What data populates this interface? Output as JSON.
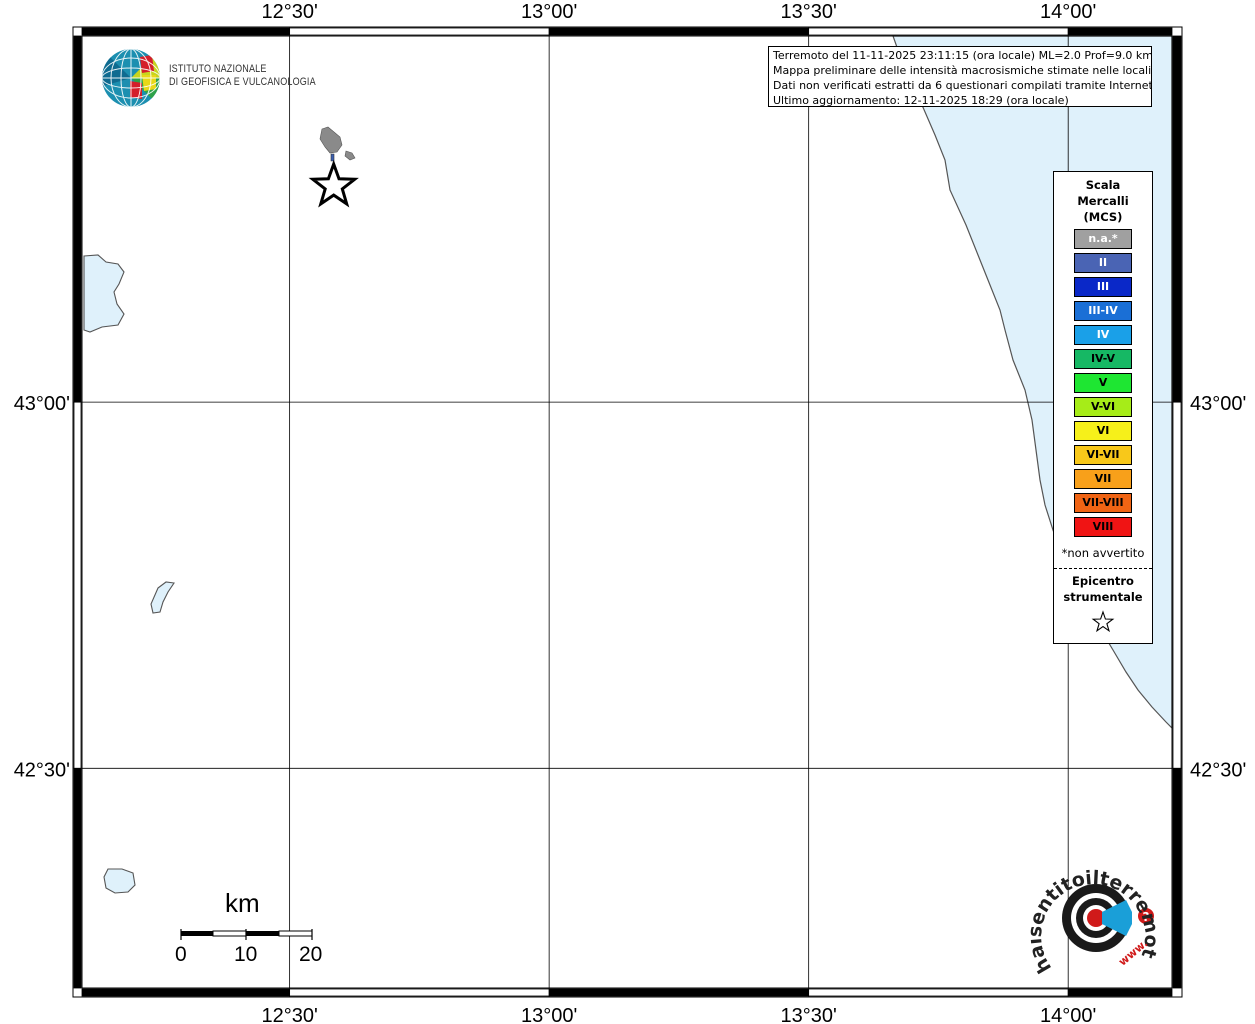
{
  "map": {
    "lon_range": [
      12.1,
      14.2
    ],
    "lat_range": [
      42.2,
      43.5
    ],
    "lon_ticks": [
      {
        "value": 12.5,
        "label": "12°30'"
      },
      {
        "value": 13.0,
        "label": "13°00'"
      },
      {
        "value": 13.5,
        "label": "13°30'"
      },
      {
        "value": 14.0,
        "label": "14°00'"
      }
    ],
    "lat_ticks": [
      {
        "value": 43.0,
        "label": "43°00'"
      },
      {
        "value": 42.5,
        "label": "42°30'"
      }
    ],
    "epicenter": {
      "lon": 12.585,
      "lat": 43.295
    },
    "water_color": "#dff1fb",
    "coast_color": "#555555",
    "land_color": "#ffffff"
  },
  "logo": {
    "line1": "ISTITUTO NAZIONALE",
    "line2": "DI GEOFISICA E VULCANOLOGIA"
  },
  "info": {
    "line1": "Terremoto del 11-11-2025 23:11:15 (ora locale) ML=2.0 Prof=9.0 km",
    "line2": "Mappa preliminare delle intensità macrosismiche stimate nelle località",
    "line3": "Dati non verificati estratti da 6 questionari compilati tramite Internet.",
    "line4": "Ultimo aggiornamento: 12-11-2025 18:29 (ora locale)"
  },
  "legend": {
    "title1": "Scala",
    "title2": "Mercalli",
    "title3": "(MCS)",
    "items": [
      {
        "label": "n.a.*",
        "color": "#a0a0a0",
        "text": "#ffffff"
      },
      {
        "label": "II",
        "color": "#4a64b4",
        "text": "#ffffff"
      },
      {
        "label": "III",
        "color": "#0a28c8",
        "text": "#ffffff"
      },
      {
        "label": "III-IV",
        "color": "#1a6fd6",
        "text": "#ffffff"
      },
      {
        "label": "IV",
        "color": "#1aa0e8",
        "text": "#ffffff"
      },
      {
        "label": "IV-V",
        "color": "#16b864",
        "text": "#000000"
      },
      {
        "label": "V",
        "color": "#1ee632",
        "text": "#000000"
      },
      {
        "label": "V-VI",
        "color": "#a6ec18",
        "text": "#000000"
      },
      {
        "label": "VI",
        "color": "#f6f01a",
        "text": "#000000"
      },
      {
        "label": "VI-VII",
        "color": "#f8c81a",
        "text": "#000000"
      },
      {
        "label": "VII",
        "color": "#f8a01a",
        "text": "#000000"
      },
      {
        "label": "VII-VIII",
        "color": "#f06414",
        "text": "#000000"
      },
      {
        "label": "VIII",
        "color": "#f01414",
        "text": "#000000"
      }
    ],
    "note": "*non avvertito",
    "epicenter_line1": "Epicentro",
    "epicenter_line2": "strumentale"
  },
  "scale": {
    "unit": "km",
    "ticks": [
      "0",
      "10",
      "20"
    ]
  },
  "hst": {
    "text": "haisentitoilterremoto.it",
    "prefix": "www."
  }
}
